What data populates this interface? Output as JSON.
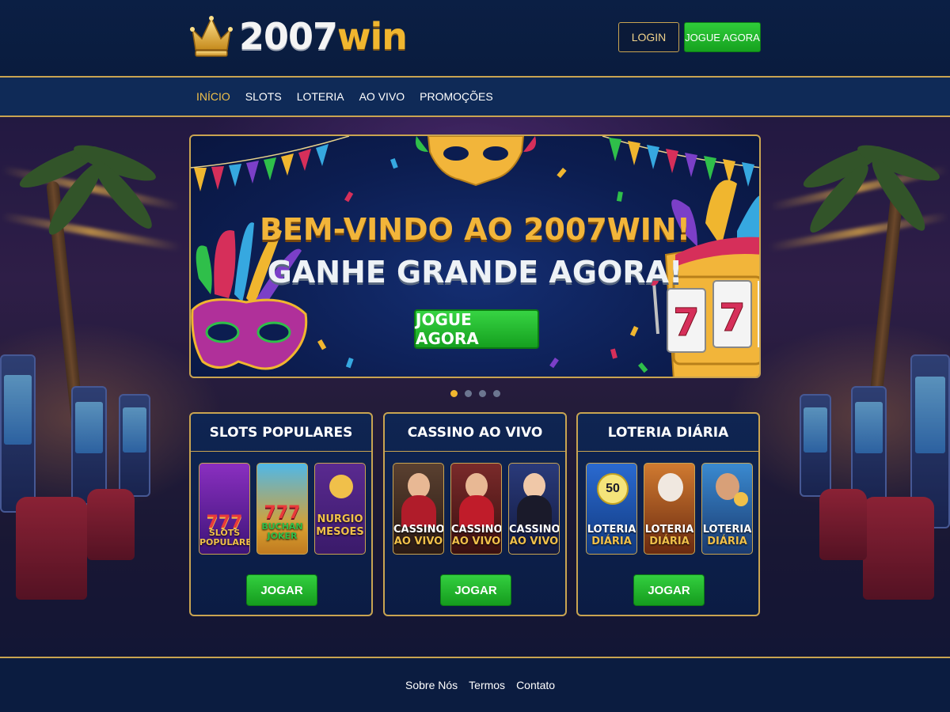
{
  "header": {
    "logo_number": "2007",
    "logo_suffix": "win",
    "login_label": "LOGIN",
    "cta_label": "JOGUE AGORA"
  },
  "nav": {
    "items": [
      {
        "label": "INÍCIO",
        "active": true
      },
      {
        "label": "SLOTS",
        "active": false
      },
      {
        "label": "LOTERIA",
        "active": false
      },
      {
        "label": "AO VIVO",
        "active": false
      },
      {
        "label": "PROMOÇÕES",
        "active": false
      }
    ]
  },
  "banner": {
    "headline": "BEM-VINDO AO 2007WIN!",
    "subheadline": "GANHE GRANDE AGORA!",
    "button_label": "JOGUE AGORA",
    "slot_digits": [
      "7",
      "7"
    ],
    "carousel": {
      "total": 4,
      "active_index": 0
    }
  },
  "cards": [
    {
      "title": "SLOTS POPULARES",
      "button_label": "JOGAR",
      "tiles": [
        {
          "line1": "777",
          "line2": "SLOTS POPULARES"
        },
        {
          "line1": "777",
          "line2": "BUCHAN JOKER"
        },
        {
          "line1": "NURGIO",
          "line2": "MESOES"
        }
      ]
    },
    {
      "title": "CASSINO AO VIVO",
      "button_label": "JOGAR",
      "tiles": [
        {
          "line1": "CASSINO",
          "line2": "AO VIVO"
        },
        {
          "line1": "CASSINO",
          "line2": "AO VIVO"
        },
        {
          "line1": "CASSINO",
          "line2": "AO VIVO"
        }
      ]
    },
    {
      "title": "LOTERIA DIÁRIA",
      "button_label": "JOGAR",
      "tiles": [
        {
          "line1": "LOTERIA",
          "line2": "DIÁRIA",
          "ball": "50"
        },
        {
          "line1": "LOTERIA",
          "line2": "DIÁRIA"
        },
        {
          "line1": "LOTERIA",
          "line2": "DIÁRIA"
        }
      ]
    }
  ],
  "footer": {
    "links": [
      "Sobre Nós",
      "Termos",
      "Contato"
    ]
  },
  "colors": {
    "accent_gold": "#c9a451",
    "brand_yellow": "#f0b62f",
    "cta_green": "#1fb52a",
    "navy": "#0b1c44"
  }
}
